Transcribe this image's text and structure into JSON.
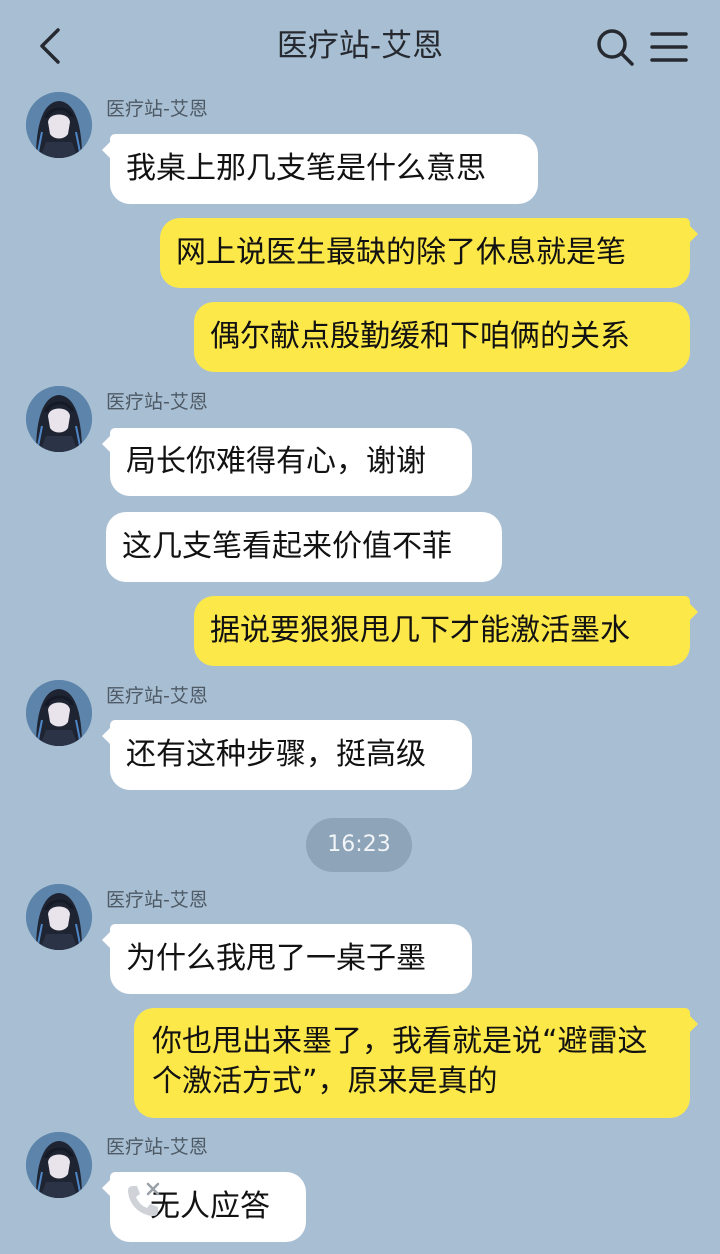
{
  "header": {
    "title": "医疗站-艾恩",
    "back_icon": "chevron-left-icon",
    "search_icon": "search-icon",
    "menu_icon": "menu-icon"
  },
  "contact": {
    "name": "医疗站-艾恩"
  },
  "messages": [
    {
      "from": "contact",
      "text": "我桌上那几支笔是什么意思"
    },
    {
      "from": "me",
      "text": "网上说医生最缺的除了休息就是笔"
    },
    {
      "from": "me",
      "text": "偶尔献点殷勤缓和下咱俩的关系"
    },
    {
      "from": "contact",
      "text": "局长你难得有心，谢谢"
    },
    {
      "from": "contact",
      "text": "这几支笔看起来价值不菲"
    },
    {
      "from": "me",
      "text": "据说要狠狠甩几下才能激活墨水"
    },
    {
      "from": "contact",
      "text": "还有这种步骤，挺高级"
    },
    {
      "type": "time",
      "text": "16:23"
    },
    {
      "from": "contact",
      "text": "为什么我甩了一桌子墨"
    },
    {
      "from": "me",
      "text": "你也甩出来墨了，我看就是说“避雷这个激活方式”，原来是真的"
    },
    {
      "from": "contact",
      "type": "missed-call",
      "text": "无人应答",
      "icon": "missed-call-icon"
    }
  ],
  "colors": {
    "background": "#a8bfd3",
    "my_bubble": "#fde84a",
    "their_bubble": "#ffffff",
    "time_pill": "#8ea4b8"
  }
}
